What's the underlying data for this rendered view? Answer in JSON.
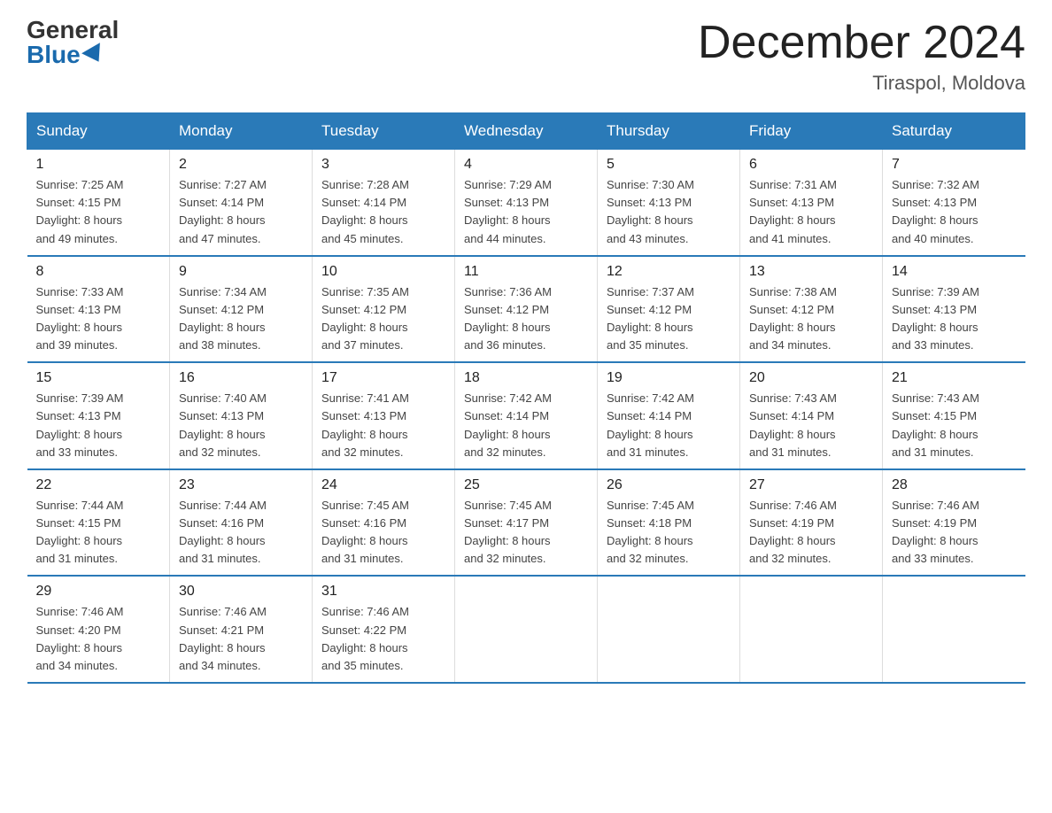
{
  "header": {
    "logo_general": "General",
    "logo_blue": "Blue",
    "month_title": "December 2024",
    "location": "Tiraspol, Moldova"
  },
  "days_of_week": [
    "Sunday",
    "Monday",
    "Tuesday",
    "Wednesday",
    "Thursday",
    "Friday",
    "Saturday"
  ],
  "weeks": [
    [
      {
        "day": "1",
        "sunrise": "7:25 AM",
        "sunset": "4:15 PM",
        "daylight": "8 hours and 49 minutes."
      },
      {
        "day": "2",
        "sunrise": "7:27 AM",
        "sunset": "4:14 PM",
        "daylight": "8 hours and 47 minutes."
      },
      {
        "day": "3",
        "sunrise": "7:28 AM",
        "sunset": "4:14 PM",
        "daylight": "8 hours and 45 minutes."
      },
      {
        "day": "4",
        "sunrise": "7:29 AM",
        "sunset": "4:13 PM",
        "daylight": "8 hours and 44 minutes."
      },
      {
        "day": "5",
        "sunrise": "7:30 AM",
        "sunset": "4:13 PM",
        "daylight": "8 hours and 43 minutes."
      },
      {
        "day": "6",
        "sunrise": "7:31 AM",
        "sunset": "4:13 PM",
        "daylight": "8 hours and 41 minutes."
      },
      {
        "day": "7",
        "sunrise": "7:32 AM",
        "sunset": "4:13 PM",
        "daylight": "8 hours and 40 minutes."
      }
    ],
    [
      {
        "day": "8",
        "sunrise": "7:33 AM",
        "sunset": "4:13 PM",
        "daylight": "8 hours and 39 minutes."
      },
      {
        "day": "9",
        "sunrise": "7:34 AM",
        "sunset": "4:12 PM",
        "daylight": "8 hours and 38 minutes."
      },
      {
        "day": "10",
        "sunrise": "7:35 AM",
        "sunset": "4:12 PM",
        "daylight": "8 hours and 37 minutes."
      },
      {
        "day": "11",
        "sunrise": "7:36 AM",
        "sunset": "4:12 PM",
        "daylight": "8 hours and 36 minutes."
      },
      {
        "day": "12",
        "sunrise": "7:37 AM",
        "sunset": "4:12 PM",
        "daylight": "8 hours and 35 minutes."
      },
      {
        "day": "13",
        "sunrise": "7:38 AM",
        "sunset": "4:12 PM",
        "daylight": "8 hours and 34 minutes."
      },
      {
        "day": "14",
        "sunrise": "7:39 AM",
        "sunset": "4:13 PM",
        "daylight": "8 hours and 33 minutes."
      }
    ],
    [
      {
        "day": "15",
        "sunrise": "7:39 AM",
        "sunset": "4:13 PM",
        "daylight": "8 hours and 33 minutes."
      },
      {
        "day": "16",
        "sunrise": "7:40 AM",
        "sunset": "4:13 PM",
        "daylight": "8 hours and 32 minutes."
      },
      {
        "day": "17",
        "sunrise": "7:41 AM",
        "sunset": "4:13 PM",
        "daylight": "8 hours and 32 minutes."
      },
      {
        "day": "18",
        "sunrise": "7:42 AM",
        "sunset": "4:14 PM",
        "daylight": "8 hours and 32 minutes."
      },
      {
        "day": "19",
        "sunrise": "7:42 AM",
        "sunset": "4:14 PM",
        "daylight": "8 hours and 31 minutes."
      },
      {
        "day": "20",
        "sunrise": "7:43 AM",
        "sunset": "4:14 PM",
        "daylight": "8 hours and 31 minutes."
      },
      {
        "day": "21",
        "sunrise": "7:43 AM",
        "sunset": "4:15 PM",
        "daylight": "8 hours and 31 minutes."
      }
    ],
    [
      {
        "day": "22",
        "sunrise": "7:44 AM",
        "sunset": "4:15 PM",
        "daylight": "8 hours and 31 minutes."
      },
      {
        "day": "23",
        "sunrise": "7:44 AM",
        "sunset": "4:16 PM",
        "daylight": "8 hours and 31 minutes."
      },
      {
        "day": "24",
        "sunrise": "7:45 AM",
        "sunset": "4:16 PM",
        "daylight": "8 hours and 31 minutes."
      },
      {
        "day": "25",
        "sunrise": "7:45 AM",
        "sunset": "4:17 PM",
        "daylight": "8 hours and 32 minutes."
      },
      {
        "day": "26",
        "sunrise": "7:45 AM",
        "sunset": "4:18 PM",
        "daylight": "8 hours and 32 minutes."
      },
      {
        "day": "27",
        "sunrise": "7:46 AM",
        "sunset": "4:19 PM",
        "daylight": "8 hours and 32 minutes."
      },
      {
        "day": "28",
        "sunrise": "7:46 AM",
        "sunset": "4:19 PM",
        "daylight": "8 hours and 33 minutes."
      }
    ],
    [
      {
        "day": "29",
        "sunrise": "7:46 AM",
        "sunset": "4:20 PM",
        "daylight": "8 hours and 34 minutes."
      },
      {
        "day": "30",
        "sunrise": "7:46 AM",
        "sunset": "4:21 PM",
        "daylight": "8 hours and 34 minutes."
      },
      {
        "day": "31",
        "sunrise": "7:46 AM",
        "sunset": "4:22 PM",
        "daylight": "8 hours and 35 minutes."
      },
      null,
      null,
      null,
      null
    ]
  ],
  "labels": {
    "sunrise": "Sunrise:",
    "sunset": "Sunset:",
    "daylight": "Daylight:"
  }
}
